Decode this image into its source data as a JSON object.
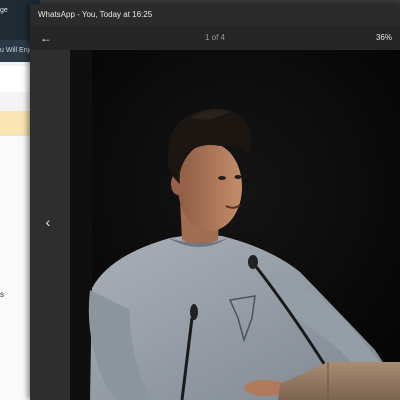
{
  "background_app": {
    "topbar_text": "ge",
    "subbar_text": "u Will Enjoy",
    "side_letter": "s"
  },
  "viewer": {
    "title": "WhatsApp - You, Today at 16:25",
    "page_counter": "1 of 4",
    "zoom": "36%",
    "back_icon": "←",
    "prev_icon": "‹"
  },
  "colors": {
    "photo_background": "#070707",
    "sweater": "#9aa2ac",
    "skin": "#b07a5b",
    "hair": "#1c1613",
    "podium": "#9a7e66"
  }
}
